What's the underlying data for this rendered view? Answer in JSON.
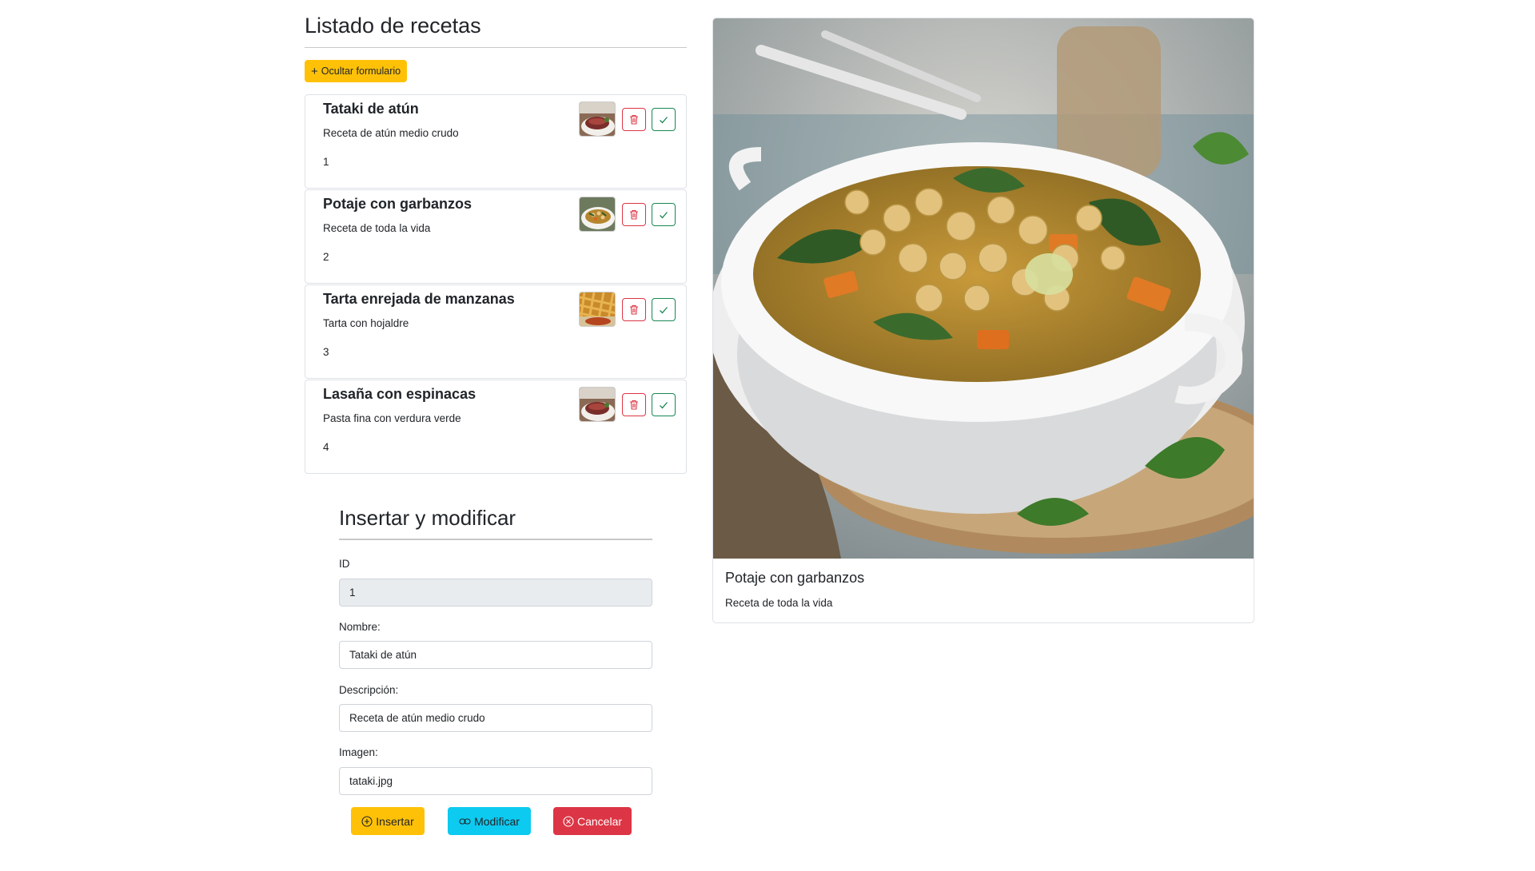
{
  "header": {
    "title": "Listado de recetas"
  },
  "toggle_button": {
    "label": "Ocultar formulario"
  },
  "recipes": [
    {
      "name": "Tataki de atún",
      "description": "Receta de atún medio crudo",
      "id": "1",
      "thumb": "tuna-steak"
    },
    {
      "name": "Potaje con garbanzos",
      "description": "Receta de toda la vida",
      "id": "2",
      "thumb": "chickpea-stew"
    },
    {
      "name": "Tarta enrejada de manzanas",
      "description": "Tarta con hojaldre",
      "id": "3",
      "thumb": "apple-lattice-pie"
    },
    {
      "name": "Lasaña con espinacas",
      "description": "Pasta fina con verdura verde",
      "id": "4",
      "thumb": "tuna-steak"
    }
  ],
  "form": {
    "title": "Insertar y modificar",
    "id_label": "ID",
    "id_value": "1",
    "name_label": "Nombre:",
    "name_value": "Tataki de atún",
    "desc_label": "Descripción:",
    "desc_value": "Receta de atún medio crudo",
    "image_label": "Imagen:",
    "image_value": "tataki.jpg",
    "insert_label": "Insertar",
    "modify_label": "Modificar",
    "cancel_label": "Cancelar"
  },
  "detail": {
    "title": "Potaje con garbanzos",
    "text": "Receta de toda la vida"
  },
  "colors": {
    "warning": "#ffc107",
    "info": "#0dcaf0",
    "danger": "#dc3545",
    "success": "#198754",
    "border": "#dee2e6"
  },
  "icons": [
    "plus-icon",
    "trash-icon",
    "check-icon",
    "plus-circle-icon",
    "link-icon",
    "x-circle-icon"
  ]
}
